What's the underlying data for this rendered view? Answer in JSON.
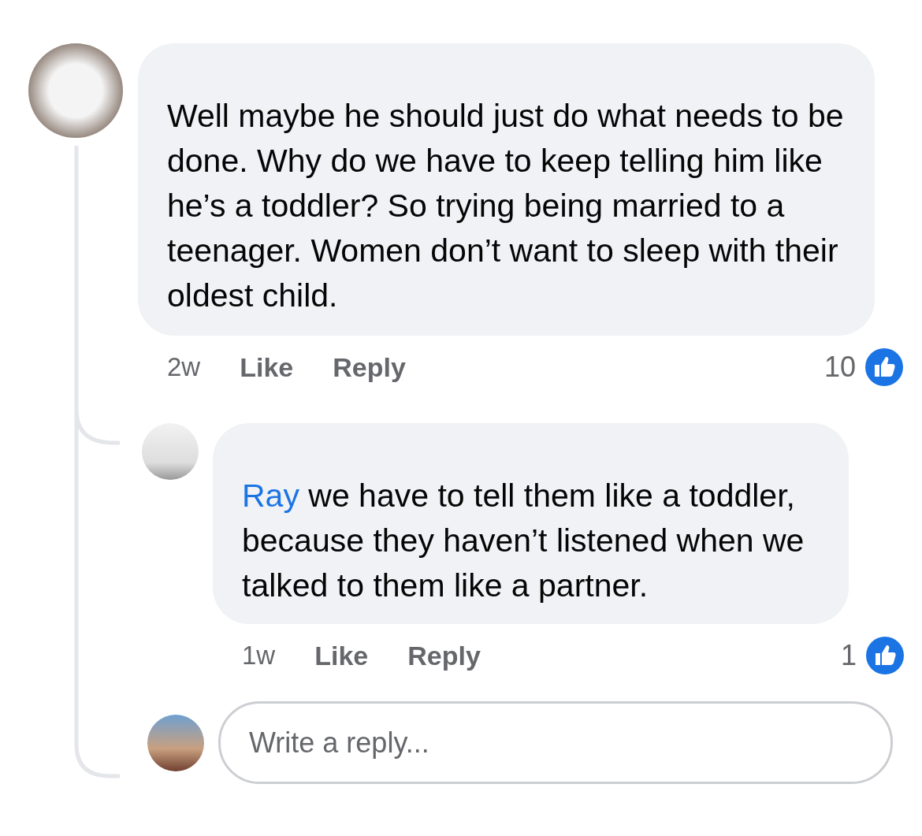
{
  "comment": {
    "text": "Well maybe he should just do what needs to be done. Why do we have to keep telling him like he’s a toddler?  So trying being married to a teenager. Women don’t want to sleep with their oldest child.",
    "time": "2w",
    "actions": [
      "Like",
      "Reply"
    ],
    "reaction_count": "10"
  },
  "reply": {
    "mention": "Ray",
    "text": "we have to tell them like a toddler, because they haven’t listened when we talked to them like a partner.",
    "time": "1w",
    "actions": [
      "Like",
      "Reply"
    ],
    "reaction_count": "1"
  },
  "reply_box": {
    "placeholder": "Write a reply..."
  }
}
